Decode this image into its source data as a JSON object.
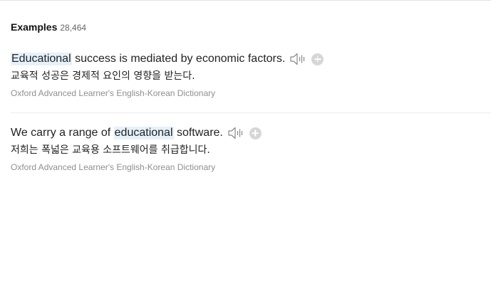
{
  "examples_section": {
    "title": "Examples",
    "count": "28,464",
    "items": [
      {
        "highlight": "Educational",
        "rest": " success is mediated by economic factors.",
        "translation": "교육적 성공은 경제적 요인의 영향을 받는다.",
        "source": "Oxford Advanced Learner's English-Korean Dictionary"
      },
      {
        "prefix": "We carry a range of ",
        "highlight": "educational",
        "rest": " software.",
        "translation": "저희는 폭넓은 교육용 소프트웨어를 취급합니다.",
        "source": "Oxford Advanced Learner's English-Korean Dictionary"
      }
    ]
  },
  "icons": {
    "speaker": "speaker-icon",
    "add": "add-to-wordbook-icon"
  },
  "colors": {
    "highlight_bg": "#e5f1fb",
    "source_text": "#8f8f8f",
    "add_button": "#d6d6d6"
  }
}
